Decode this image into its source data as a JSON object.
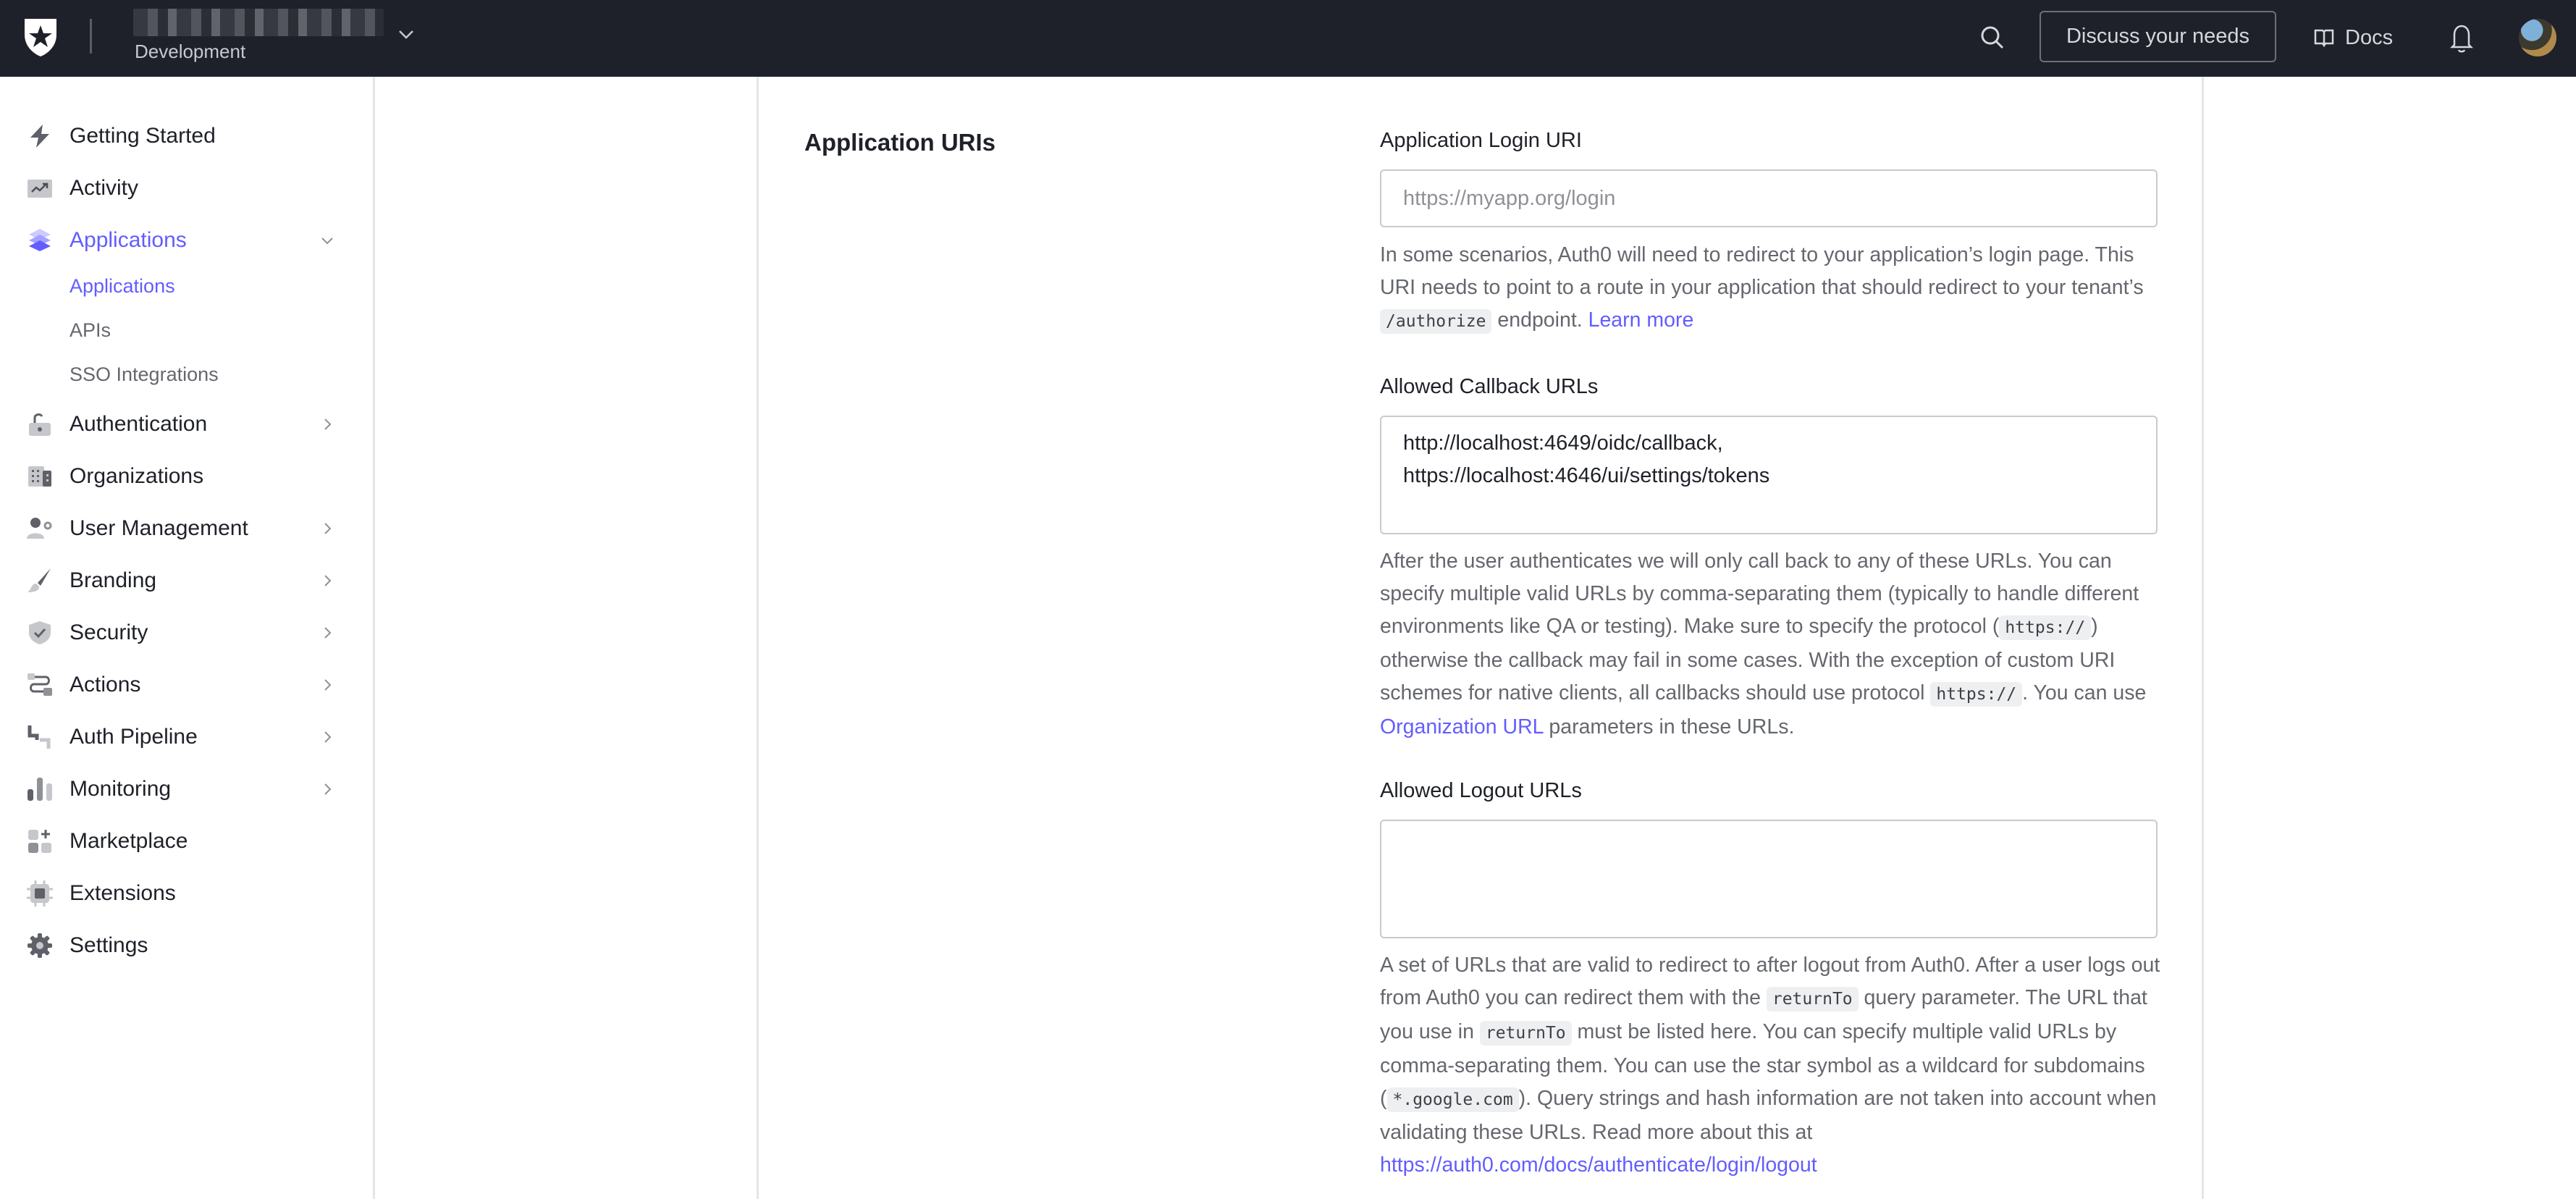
{
  "header": {
    "tenant_name": "(redacted tenant name)",
    "tenant_environment": "Development",
    "discuss_button": "Discuss your needs",
    "docs_link": "Docs",
    "colors": {
      "bg": "#1f212a"
    }
  },
  "sidebar": {
    "items": [
      {
        "label": "Getting Started",
        "icon": "lightning-icon",
        "has_chevron": false
      },
      {
        "label": "Activity",
        "icon": "trending-chart-icon",
        "has_chevron": false
      },
      {
        "label": "Applications",
        "icon": "layers-icon",
        "has_chevron": true,
        "expanded": true,
        "active": true,
        "children": [
          {
            "label": "Applications",
            "active": true
          },
          {
            "label": "APIs",
            "active": false
          },
          {
            "label": "SSO Integrations",
            "active": false
          }
        ]
      },
      {
        "label": "Authentication",
        "icon": "unlock-icon",
        "has_chevron": true
      },
      {
        "label": "Organizations",
        "icon": "building-icon",
        "has_chevron": false
      },
      {
        "label": "User Management",
        "icon": "user-gear-icon",
        "has_chevron": true
      },
      {
        "label": "Branding",
        "icon": "paintbrush-icon",
        "has_chevron": true
      },
      {
        "label": "Security",
        "icon": "shield-check-icon",
        "has_chevron": true
      },
      {
        "label": "Actions",
        "icon": "flow-icon",
        "has_chevron": true
      },
      {
        "label": "Auth Pipeline",
        "icon": "pipe-icon",
        "has_chevron": true
      },
      {
        "label": "Monitoring",
        "icon": "bar-chart-icon",
        "has_chevron": true
      },
      {
        "label": "Marketplace",
        "icon": "grid-plus-icon",
        "has_chevron": false
      },
      {
        "label": "Extensions",
        "icon": "chip-icon",
        "has_chevron": false
      },
      {
        "label": "Settings",
        "icon": "gear-icon",
        "has_chevron": false
      }
    ],
    "accent_color": "#635dff"
  },
  "main": {
    "section_title": "Application URIs",
    "login_uri": {
      "label": "Application Login URI",
      "value": "",
      "placeholder": "https://myapp.org/login",
      "help_1": "In some scenarios, Auth0 will need to redirect to your application’s login page. This URI needs to point to a route in your application that should redirect to your tenant’s ",
      "help_code": "/authorize",
      "help_2": " endpoint. ",
      "help_link": "Learn more"
    },
    "callback_urls": {
      "label": "Allowed Callback URLs",
      "value": "http://localhost:4649/oidc/callback,\nhttps://localhost:4646/ui/settings/tokens",
      "help_1": "After the user authenticates we will only call back to any of these URLs. You can specify multiple valid URLs by comma-separating them (typically to handle different environments like QA or testing). Make sure to specify the protocol (",
      "help_code_1": "https://",
      "help_2": ") otherwise the callback may fail in some cases. With the exception of custom URI schemes for native clients, all callbacks should use protocol ",
      "help_code_2": "https://",
      "help_3": ". You can use ",
      "help_link": "Organization URL",
      "help_4": " parameters in these URLs."
    },
    "logout_urls": {
      "label": "Allowed Logout URLs",
      "value": "",
      "help_1": "A set of URLs that are valid to redirect to after logout from Auth0. After a user logs out from Auth0 you can redirect them with the ",
      "help_code_1": "returnTo",
      "help_2": " query parameter. The URL that you use in ",
      "help_code_2": "returnTo",
      "help_3": " must be listed here. You can specify multiple valid URLs by comma-separating them. You can use the star symbol as a wildcard for subdomains (",
      "help_code_3": "*.google.com",
      "help_4": "). Query strings and hash information are not taken into account when validating these URLs. Read more about this at ",
      "help_link": "https://auth0.com/docs/authenticate/login/logout"
    }
  }
}
